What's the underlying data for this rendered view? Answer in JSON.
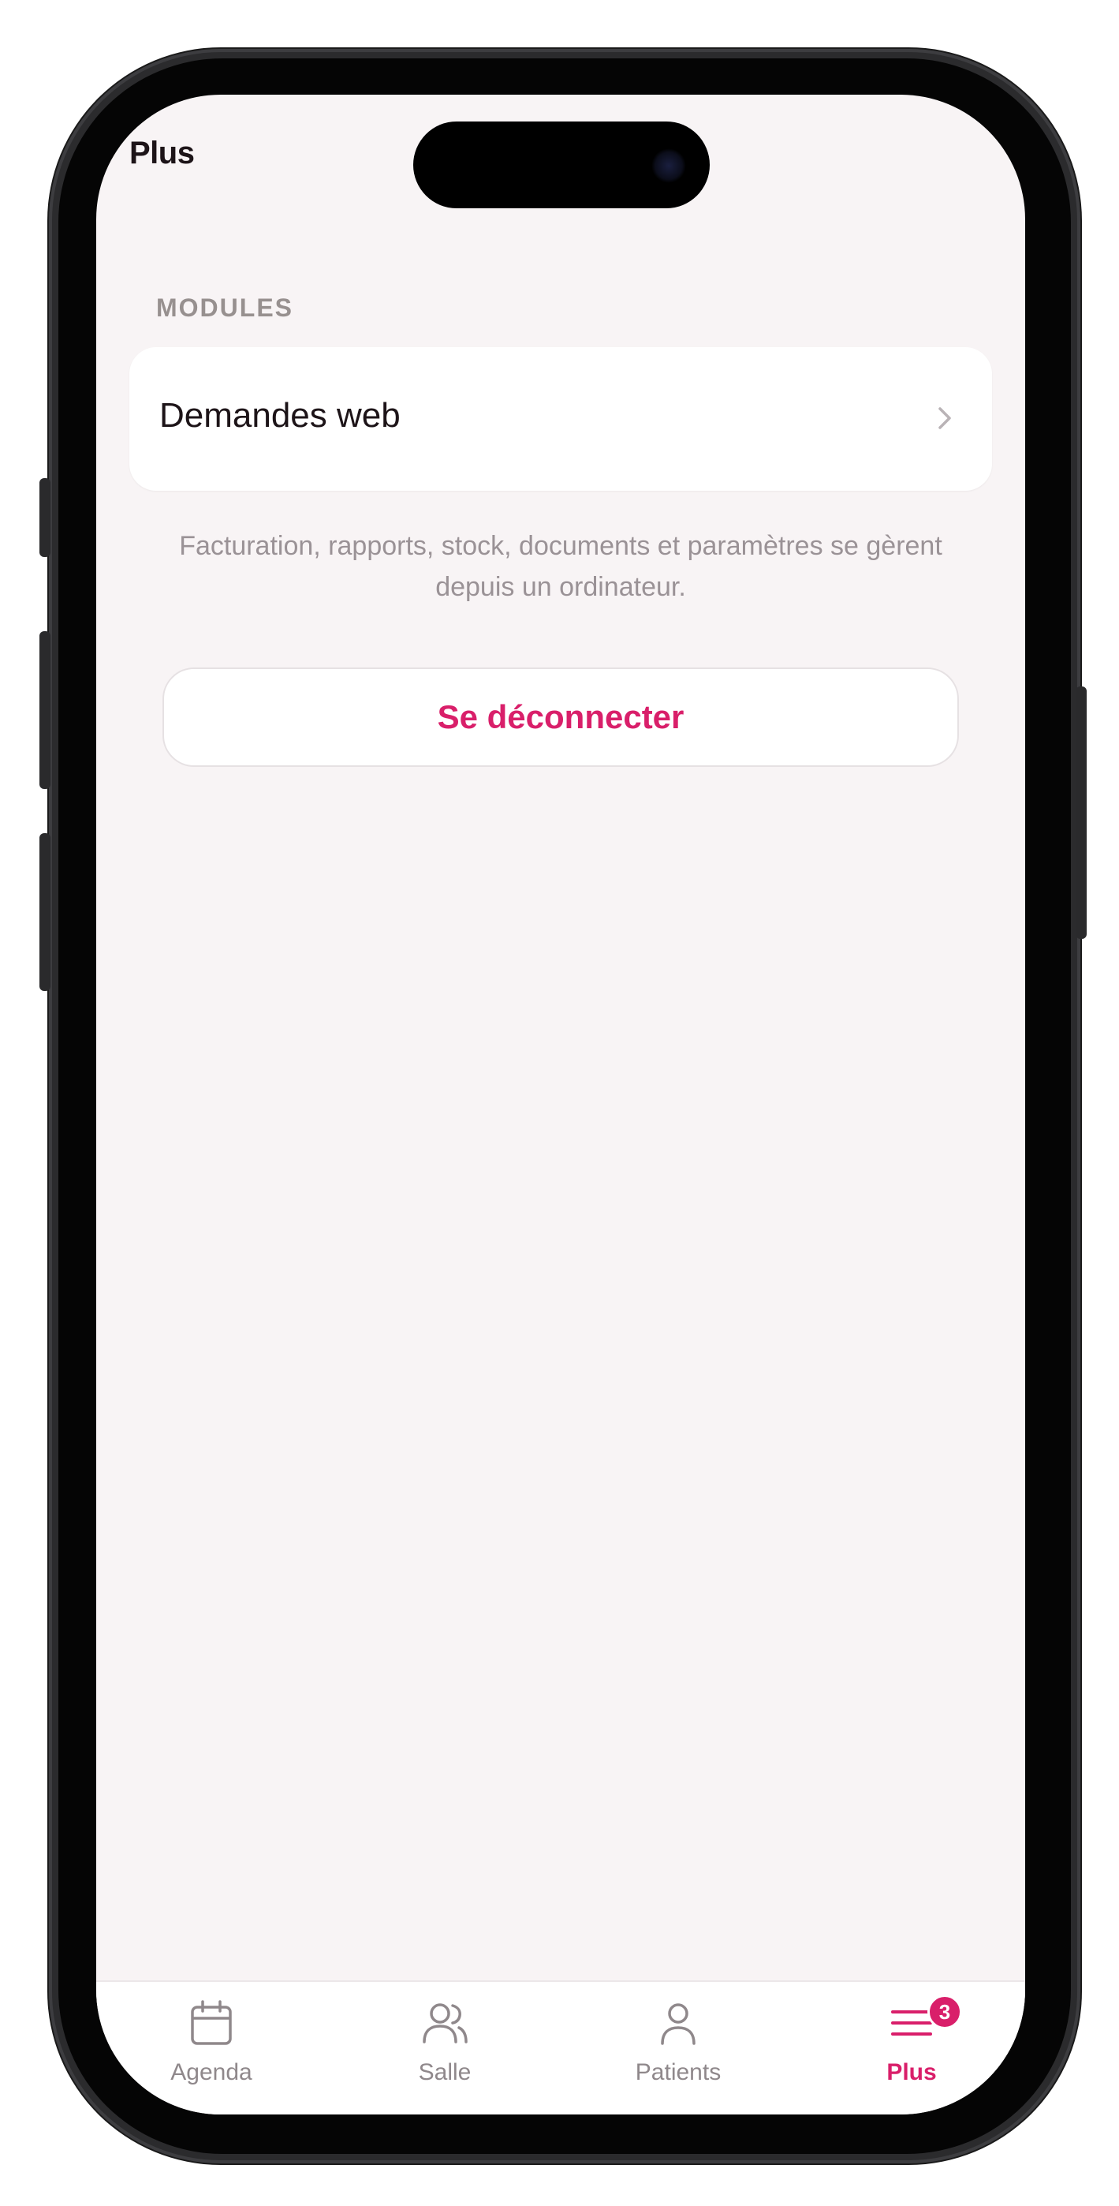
{
  "header": {
    "title": "Plus"
  },
  "modules": {
    "section_label": "MODULES",
    "items": [
      {
        "label": "Demandes web",
        "icon": "chevron-right-icon"
      }
    ],
    "note": "Facturation, rapports, stock, documents et paramètres se gèrent depuis un ordinateur."
  },
  "logout": {
    "label": "Se déconnecter"
  },
  "tabbar": {
    "tabs": [
      {
        "label": "Agenda",
        "icon": "calendar-icon",
        "active": false
      },
      {
        "label": "Salle",
        "icon": "users-icon",
        "active": false
      },
      {
        "label": "Patients",
        "icon": "user-icon",
        "active": false
      },
      {
        "label": "Plus",
        "icon": "menu-icon",
        "active": true,
        "badge": "3"
      }
    ]
  },
  "colors": {
    "accent": "#d91f6a",
    "background": "#f8f4f5",
    "muted_text": "#9a9296",
    "inactive_tab": "#8f888b"
  }
}
